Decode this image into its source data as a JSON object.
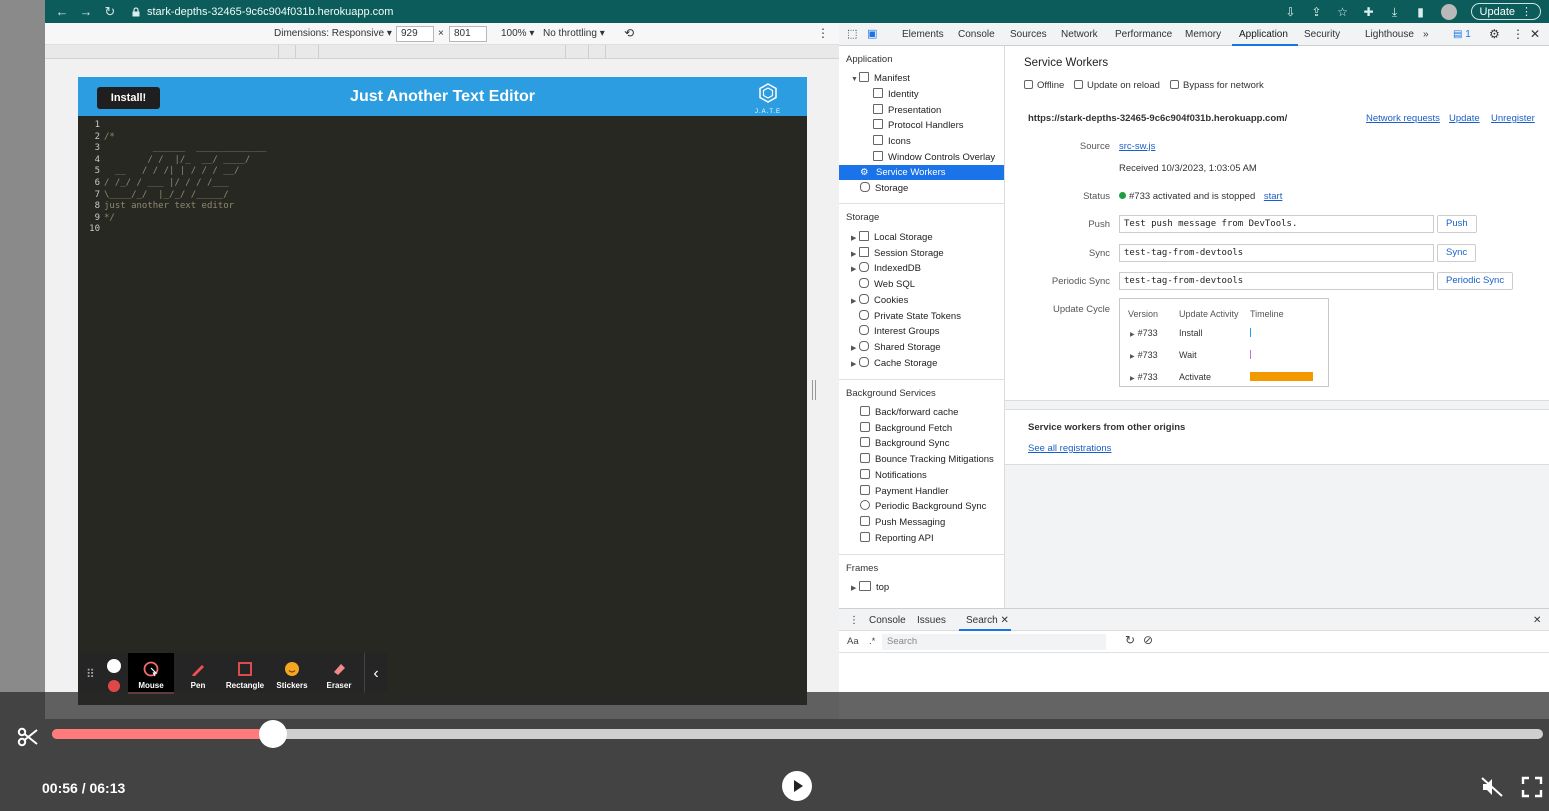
{
  "browser": {
    "url": "stark-depths-32465-9c6c904f031b.herokuapp.com",
    "update_label": "Update"
  },
  "device_toolbar": {
    "dimensions_label": "Dimensions: Responsive",
    "width": "929",
    "times": "×",
    "height": "801",
    "zoom": "100%",
    "throttling": "No throttling"
  },
  "app": {
    "install_label": "Install!",
    "title": "Just Another Text Editor",
    "logo_text": "J.A.T.E",
    "editor_lines": [
      {
        "n": "1",
        "code": ""
      },
      {
        "n": "2",
        "code": "/*"
      },
      {
        "n": "3",
        "code": "         ______  _____________"
      },
      {
        "n": "4",
        "code": "        / /  |/_  __/ ____/"
      },
      {
        "n": "5",
        "code": "  __   / / /| | / / / __/"
      },
      {
        "n": "6",
        "code": "/ /_/ / ___ |/ / / /___"
      },
      {
        "n": "7",
        "code": "\\____/_/  |_/_/ /_____/"
      },
      {
        "n": "8",
        "code": "just another text editor"
      },
      {
        "n": "9",
        "code": "*/"
      },
      {
        "n": "10",
        "code": ""
      }
    ]
  },
  "annotation_toolbar": {
    "items": [
      "Mouse",
      "Pen",
      "Rectangle",
      "Stickers",
      "Eraser"
    ]
  },
  "devtools": {
    "tabs": [
      "Elements",
      "Console",
      "Sources",
      "Network",
      "Performance",
      "Memory",
      "Application",
      "Security",
      "Lighthouse"
    ],
    "issues_badge": "1",
    "sidebar": {
      "application_header": "Application",
      "application_items": [
        "Manifest",
        "Identity",
        "Presentation",
        "Protocol Handlers",
        "Icons",
        "Window Controls Overlay",
        "Service Workers",
        "Storage"
      ],
      "storage_header": "Storage",
      "storage_items": [
        "Local Storage",
        "Session Storage",
        "IndexedDB",
        "Web SQL",
        "Cookies",
        "Private State Tokens",
        "Interest Groups",
        "Shared Storage",
        "Cache Storage"
      ],
      "background_header": "Background Services",
      "background_items": [
        "Back/forward cache",
        "Background Fetch",
        "Background Sync",
        "Bounce Tracking Mitigations",
        "Notifications",
        "Payment Handler",
        "Periodic Background Sync",
        "Push Messaging",
        "Reporting API"
      ],
      "frames_header": "Frames",
      "frames_items": [
        "top"
      ]
    },
    "service_workers": {
      "title": "Service Workers",
      "offline": "Offline",
      "update_on_reload": "Update on reload",
      "bypass_for_network": "Bypass for network",
      "origin": "https://stark-depths-32465-9c6c904f031b.herokuapp.com/",
      "network_requests": "Network requests",
      "update": "Update",
      "unregister": "Unregister",
      "source_label": "Source",
      "source_file": "src-sw.js",
      "received": "Received 10/3/2023, 1:03:05 AM",
      "status_label": "Status",
      "status_text": "#733 activated and is stopped",
      "status_action": "start",
      "push_label": "Push",
      "push_value": "Test push message from DevTools.",
      "push_button": "Push",
      "sync_label": "Sync",
      "sync_value": "test-tag-from-devtools",
      "sync_button": "Sync",
      "periodic_label": "Periodic Sync",
      "periodic_value": "test-tag-from-devtools",
      "periodic_button": "Periodic Sync",
      "update_cycle_label": "Update Cycle",
      "uc_headers": [
        "Version",
        "Update Activity",
        "Timeline"
      ],
      "uc_rows": [
        {
          "version": "#733",
          "activity": "Install"
        },
        {
          "version": "#733",
          "activity": "Wait"
        },
        {
          "version": "#733",
          "activity": "Activate"
        }
      ],
      "other_origins_title": "Service workers from other origins",
      "see_all": "See all registrations"
    },
    "drawer": {
      "tabs": [
        "Console",
        "Issues",
        "Search"
      ],
      "aa": "Aa",
      "regex": ".*",
      "search_placeholder": "Search"
    }
  },
  "player": {
    "time": "00:56 / 06:13",
    "progress_fraction": 0.148,
    "accent_color": "#ff7b7b"
  }
}
